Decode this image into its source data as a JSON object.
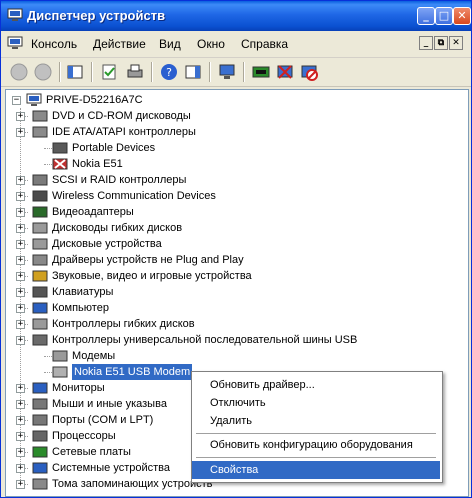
{
  "window": {
    "title": "Диспетчер устройств"
  },
  "titlebar_buttons": {
    "minimize": "_",
    "maximize": "□",
    "close": "✕"
  },
  "menu": {
    "items": [
      "Консоль",
      "Действие",
      "Вид",
      "Окно",
      "Справка"
    ]
  },
  "mdi_buttons": {
    "minimize": "_",
    "restore": "⧉",
    "close": "✕"
  },
  "toolbar": {
    "icons": [
      "back-icon",
      "forward-icon",
      "console-tree-icon",
      "update-driver-icon",
      "print-icon",
      "help-icon",
      "details-icon",
      "scan-hardware-icon",
      "device-props-icon",
      "uninstall-icon",
      "disable-icon"
    ]
  },
  "tree": {
    "root": "PRIVE-D52216A7C",
    "items": [
      "DVD и CD-ROM дисководы",
      "IDE ATA/ATAPI контроллеры",
      "Portable Devices",
      "Nokia E51",
      "SCSI и RAID контроллеры",
      "Wireless Communication Devices",
      "Видеоадаптеры",
      "Дисководы гибких дисков",
      "Дисковые устройства",
      "Драйверы устройств не Plug and Play",
      "Звуковые, видео и игровые устройства",
      "Клавиатуры",
      "Компьютер",
      "Контроллеры гибких дисков",
      "Контроллеры универсальной последовательной шины USB",
      "Модемы",
      "Nokia E51 USB Modem",
      "Мониторы",
      "Мыши и иные указыва",
      "Порты (COM и LPT)",
      "Процессоры",
      "Сетевые платы",
      "Системные устройства",
      "Тома запоминающих устройств"
    ]
  },
  "context_menu": {
    "items": [
      "Обновить драйвер...",
      "Отключить",
      "Удалить",
      "Обновить конфигурацию оборудования",
      "Свойства"
    ]
  }
}
